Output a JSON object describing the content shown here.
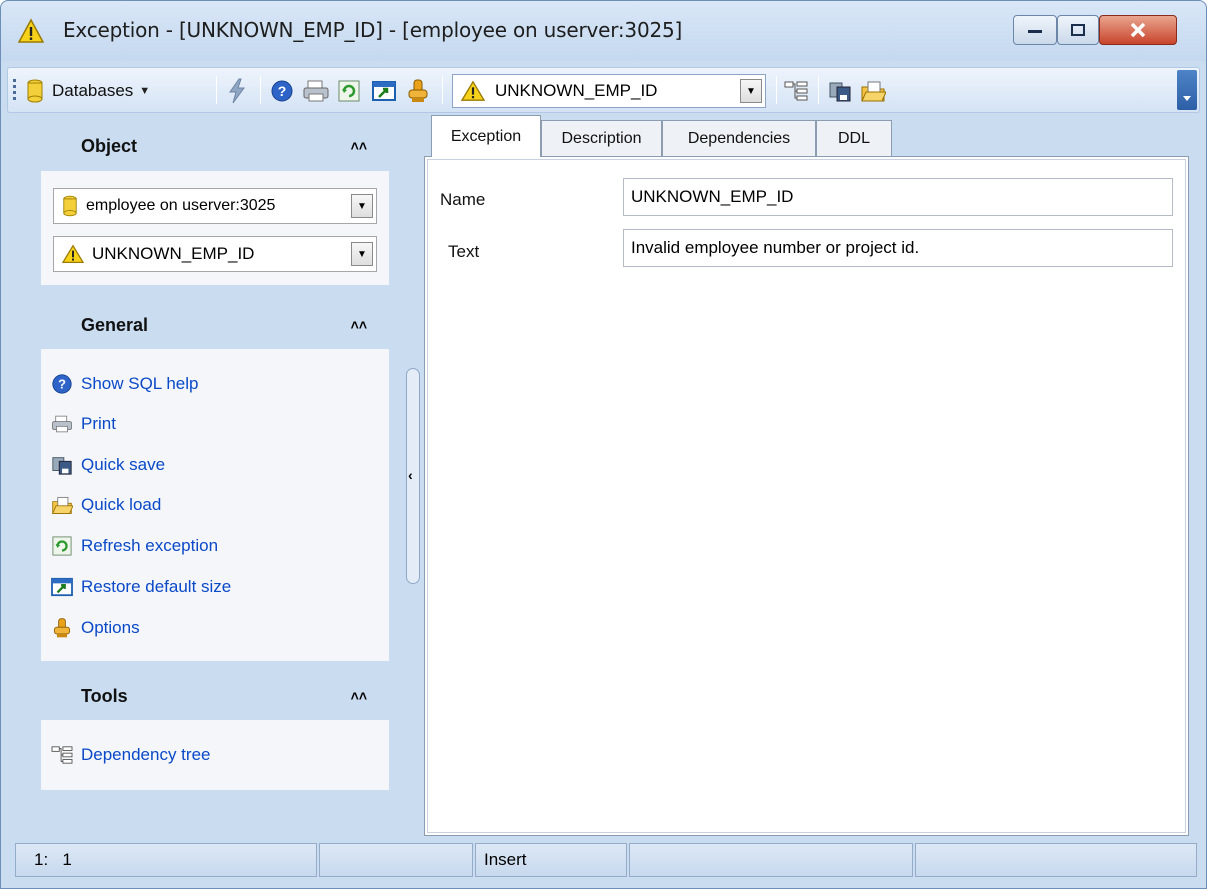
{
  "window": {
    "title": "Exception - [UNKNOWN_EMP_ID] - [employee on userver:3025]",
    "title_icon": "warning-icon",
    "accent": "#2d5fa6"
  },
  "toolbar": {
    "databases_label": "Databases",
    "object_combo_value": "UNKNOWN_EMP_ID",
    "icons": [
      "database-icon",
      "execute-icon",
      "help-icon",
      "print-icon",
      "refresh-icon",
      "restore-size-icon",
      "options-icon",
      "warning-icon",
      "dependency-tree-icon",
      "quick-save-icon",
      "quick-load-icon"
    ]
  },
  "sidebar": {
    "object": {
      "title": "Object",
      "database_value": "employee on userver:3025",
      "exception_value": "UNKNOWN_EMP_ID"
    },
    "general": {
      "title": "General",
      "items": [
        {
          "label": "Show SQL help",
          "icon": "help-icon"
        },
        {
          "label": "Print",
          "icon": "print-icon"
        },
        {
          "label": "Quick save",
          "icon": "quick-save-icon"
        },
        {
          "label": "Quick load",
          "icon": "quick-load-icon"
        },
        {
          "label": "Refresh exception",
          "icon": "refresh-icon"
        },
        {
          "label": "Restore default size",
          "icon": "restore-size-icon"
        },
        {
          "label": "Options",
          "icon": "options-icon"
        }
      ]
    },
    "tools": {
      "title": "Tools",
      "items": [
        {
          "label": "Dependency tree",
          "icon": "dependency-tree-icon"
        }
      ]
    }
  },
  "tabs": [
    {
      "label": "Exception",
      "active": true
    },
    {
      "label": "Description",
      "active": false
    },
    {
      "label": "Dependencies",
      "active": false
    },
    {
      "label": "DDL",
      "active": false
    }
  ],
  "form": {
    "name_label": "Name",
    "name_value": "UNKNOWN_EMP_ID",
    "text_label": "Text",
    "text_value": "Invalid employee number or project id."
  },
  "statusbar": {
    "position": "1:   1",
    "mode": "Insert"
  }
}
